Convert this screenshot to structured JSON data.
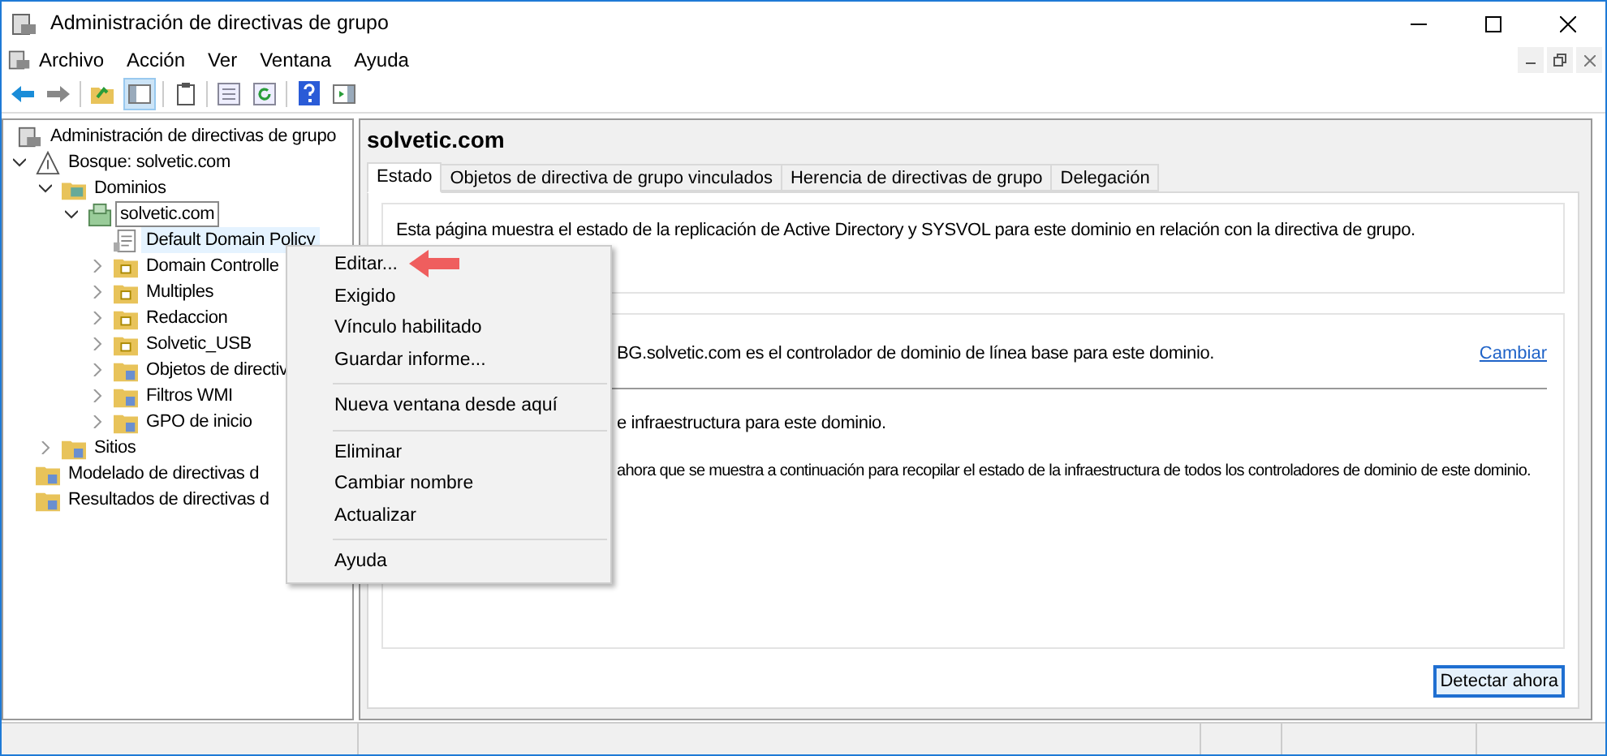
{
  "window": {
    "title": "Administración de directivas de grupo"
  },
  "menu_bar": [
    "Archivo",
    "Acción",
    "Ver",
    "Ventana",
    "Ayuda"
  ],
  "tree": [
    {
      "label": "Administración de directivas de grupo",
      "kind": "console",
      "selected": false,
      "focused": false,
      "children": [
        {
          "label": "Bosque: solvetic.com",
          "kind": "forest",
          "expanded": true,
          "selected": false,
          "focused": false,
          "children": [
            {
              "label": "Dominios",
              "kind": "domains",
              "expanded": true,
              "selected": false,
              "focused": false,
              "children": [
                {
                  "label": "solvetic.com",
                  "kind": "domain",
                  "expanded": true,
                  "selected": false,
                  "focused": true,
                  "children": [
                    {
                      "label": "Default Domain Policy",
                      "kind": "gpo",
                      "selected": true,
                      "focused": false
                    },
                    {
                      "label": "Domain Controlle",
                      "kind": "ou",
                      "expanded": false,
                      "selected": false,
                      "focused": false
                    },
                    {
                      "label": "Multiples",
                      "kind": "ou",
                      "expanded": false,
                      "selected": false,
                      "focused": false
                    },
                    {
                      "label": "Redaccion",
                      "kind": "ou",
                      "expanded": false,
                      "selected": false,
                      "focused": false
                    },
                    {
                      "label": "Solvetic_USB",
                      "kind": "ou",
                      "expanded": false,
                      "selected": false,
                      "focused": false
                    },
                    {
                      "label": "Objetos de directiv",
                      "kind": "folder",
                      "expanded": false,
                      "selected": false,
                      "focused": false
                    },
                    {
                      "label": "Filtros WMI",
                      "kind": "folder",
                      "expanded": false,
                      "selected": false,
                      "focused": false
                    },
                    {
                      "label": "GPO de inicio",
                      "kind": "folder",
                      "expanded": false,
                      "selected": false,
                      "focused": false
                    }
                  ]
                }
              ]
            },
            {
              "label": "Sitios",
              "kind": "folder",
              "expanded": false,
              "selected": false,
              "focused": false
            }
          ]
        },
        {
          "label": "Modelado de directivas d",
          "kind": "folder",
          "selected": false,
          "focused": false
        },
        {
          "label": "Resultados de directivas d",
          "kind": "folder",
          "selected": false,
          "focused": false
        }
      ]
    }
  ],
  "detail": {
    "title": "solvetic.com",
    "tabs": [
      {
        "label": "Estado",
        "selected": true
      },
      {
        "label": "Objetos de directiva de grupo vinculados",
        "selected": false
      },
      {
        "label": "Herencia de directivas de grupo",
        "selected": false
      },
      {
        "label": "Delegación",
        "selected": false
      }
    ],
    "intro": "Esta página muestra el estado de la replicación de Active Directory y SYSVOL para este dominio en relación con la directiva de grupo.",
    "baseline": "BG.solvetic.com es el controlador de dominio de línea base para este dominio.",
    "change_link": "Cambiar",
    "infra": "e infraestructura para este dominio.",
    "detect_hint": "ahora que se muestra a continuación para recopilar el estado de la infraestructura de todos los controladores de dominio de este dominio.",
    "detect_button": "Detectar ahora"
  },
  "context_menu": [
    [
      "Editar...",
      "Exigido",
      "Vínculo habilitado",
      "Guardar informe..."
    ],
    [
      "Nueva ventana desde aquí"
    ],
    [
      "Eliminar",
      "Cambiar nombre",
      "Actualizar"
    ],
    [
      "Ayuda"
    ]
  ]
}
